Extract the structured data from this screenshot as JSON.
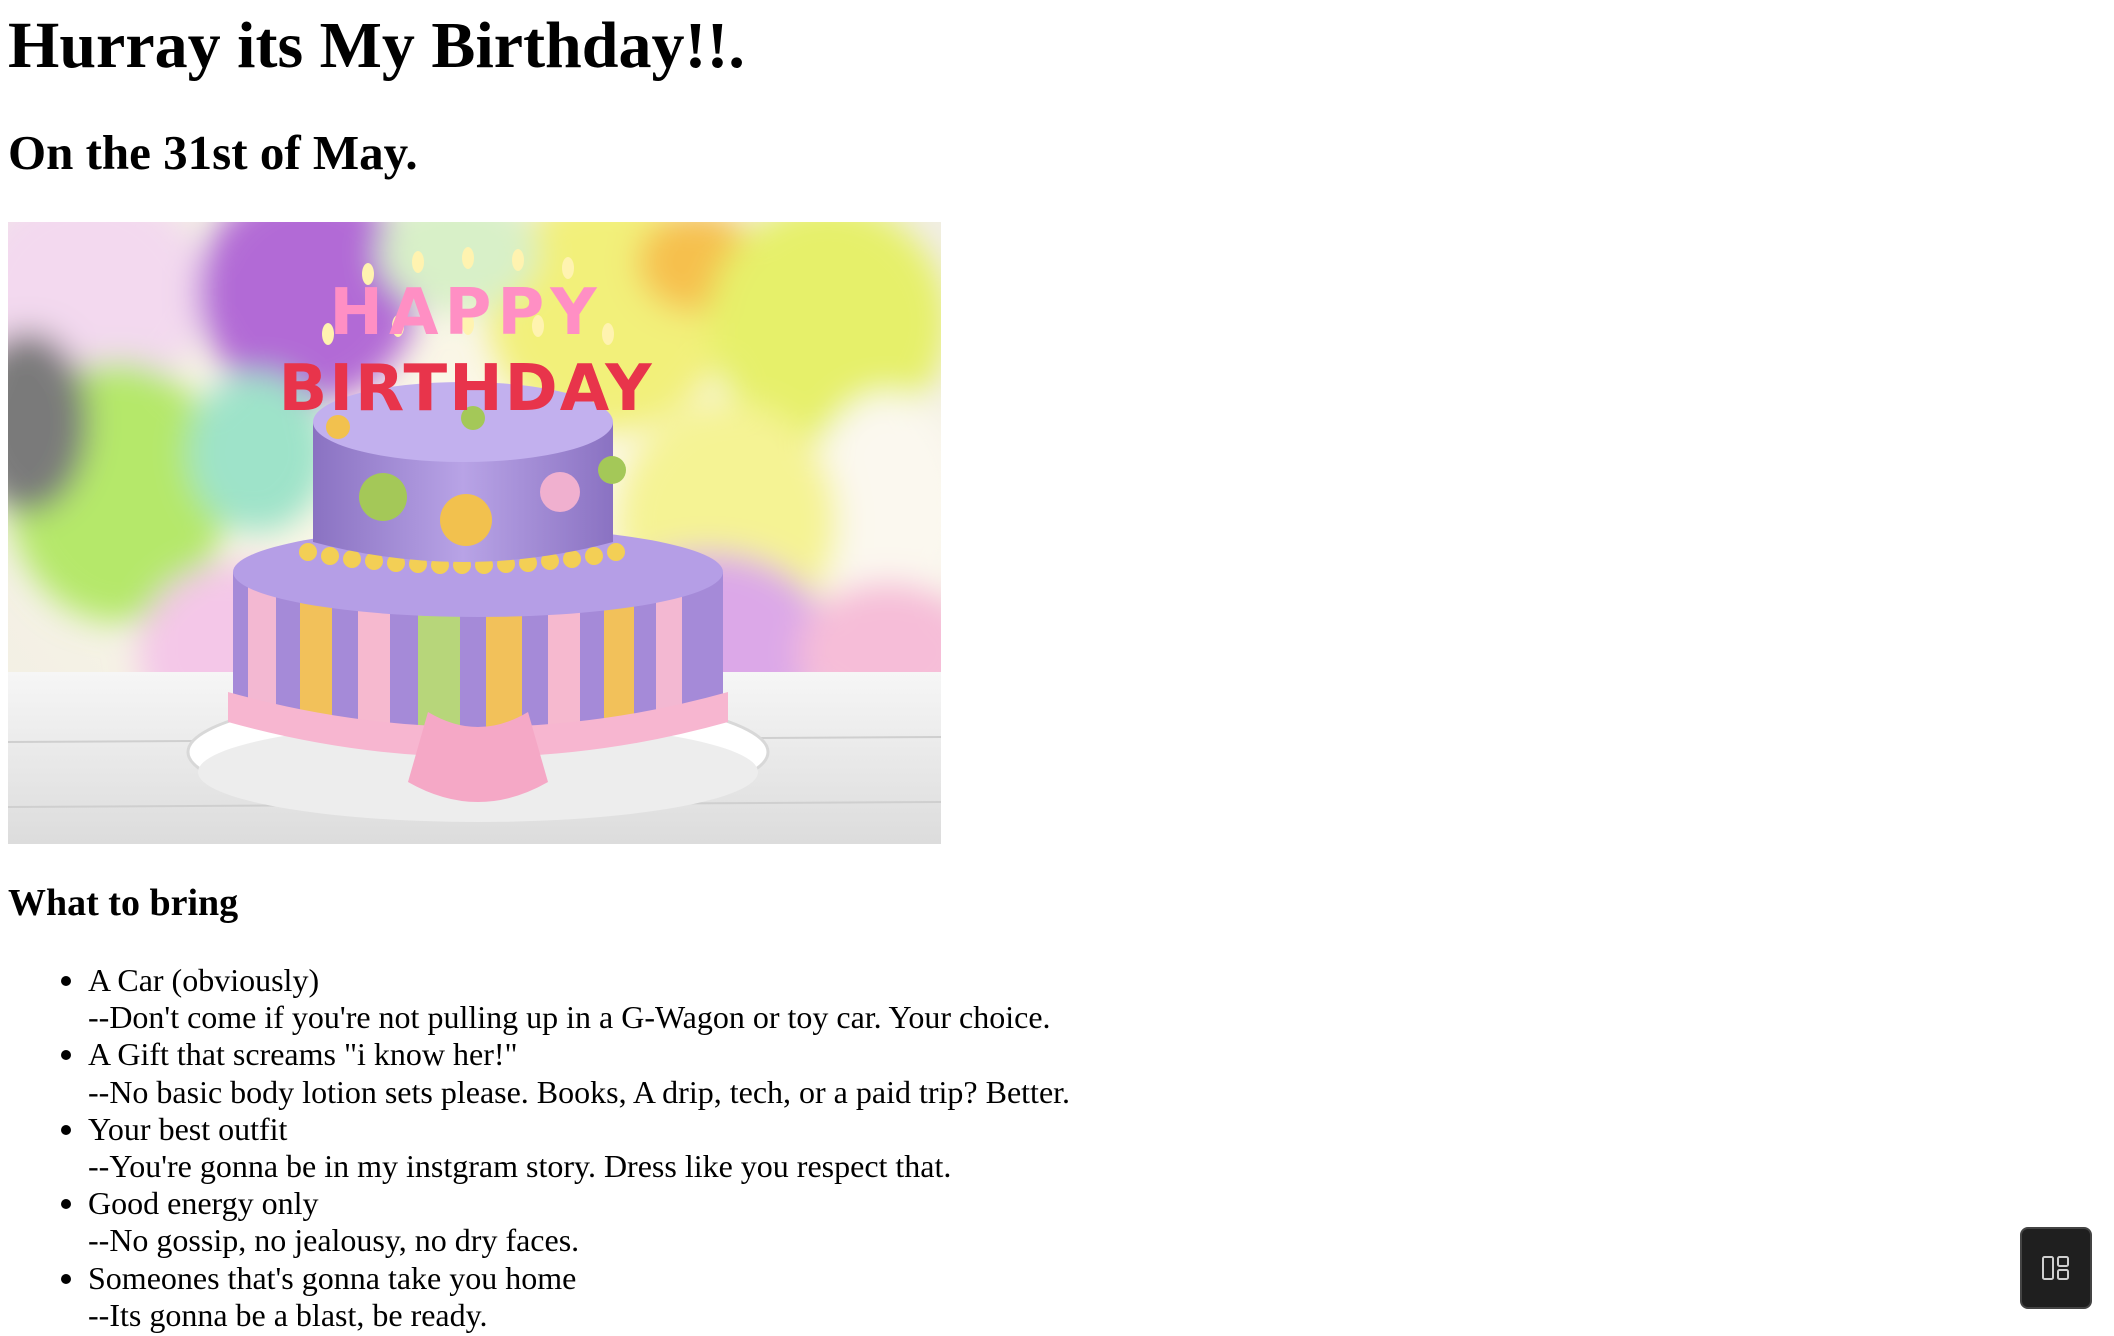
{
  "page": {
    "title": "Hurray its My Birthday!!.",
    "subtitle": "On the 31st of May."
  },
  "image": {
    "description": "Birthday cake with Happy Birthday candles",
    "candle_text_top": "HAPPY",
    "candle_text_bottom": "BIRTHDAY"
  },
  "section": {
    "heading": "What to bring"
  },
  "items": [
    {
      "title": "A Car (obviously)",
      "note": "--Don't come if you're not pulling up in a G-Wagon or toy car. Your choice."
    },
    {
      "title": "A Gift that screams \"i know her!\"",
      "note": "--No basic body lotion sets please. Books, A drip, tech, or a paid trip? Better."
    },
    {
      "title": "Your best outfit",
      "note": "--You're gonna be in my instgram story. Dress like you respect that."
    },
    {
      "title": "Good energy only",
      "note": "--No gossip, no jealousy, no dry faces."
    },
    {
      "title": "Someones that's gonna take you home",
      "note": "--Its gonna be a blast, be ready."
    }
  ],
  "widget": {
    "icon": "layout-panel-icon"
  }
}
